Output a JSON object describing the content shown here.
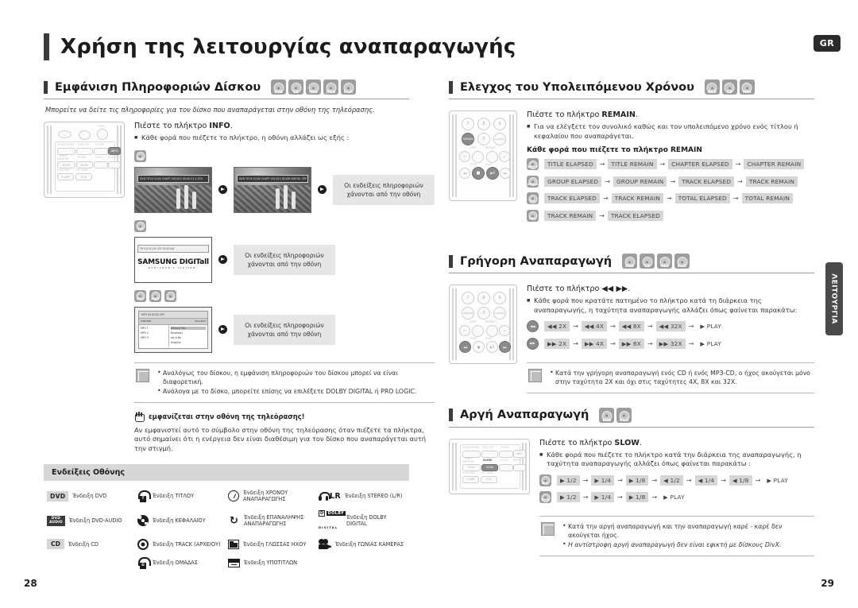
{
  "document": {
    "title": "Χρήση της λειτουργίας αναπαραγωγής",
    "locale_badge": "GR",
    "side_tab": "ΛΕΙΤΟΥΡΓΙΑ",
    "page_left": "28",
    "page_right": "29"
  },
  "sections": {
    "disc_info": {
      "heading": "Εμφάνιση Πληροφοριών Δίσκου",
      "badges": [
        "DVD",
        "CD",
        "MP3",
        "JPEG",
        "DivX"
      ],
      "intro": "Μπορείτε να δείτε τις πληροφορίες για τον δίσκο που αναπαράγεται στην οθόνη της τηλεόρασης.",
      "lead_prefix": "Πιέστε το πλήκτρο ",
      "lead_key": "INFO",
      "lead_suffix": ".",
      "bullets": [
        "Κάθε φορά που πιέζετε το πλήκτρο, η οθόνη αλλάζει ως εξής :"
      ],
      "row1_badge": "DVD",
      "row1_osd_a": "DVD  TITLE 01/05  CHAPT 001/012  00:00:21  5.1CH",
      "row1_osd_b": "DVD  TITLE 01/05  CHAPT 001/012  DOLBY DIGITAL  OFF",
      "row1_callout": "Οι ενδείξεις πληροφοριών χάνονται από την οθόνη",
      "row2_badge": "CD",
      "row2_osd": "TR  01/15  L/R  OFF  00:03:06",
      "row2_logo": "SAMSUNG DIGITall",
      "row2_logo_sub": "everyone's invited.",
      "row2_callout": "Οι ενδείξεις πληροφοριών χάνονται από την οθόνη",
      "row3_badges": [
        "MP3",
        "JPEG",
        "DivX"
      ],
      "row3_osd": "MP3  00:00:02  OFF",
      "row3_sorting": "SORTING",
      "row3_playlist": "PLAYLIST",
      "row3_left_items": [
        "MP3 1",
        "MP3 2",
        "MP3 3"
      ],
      "row3_right_items": [
        "Without You",
        "Yesterday",
        "Let it Be",
        "Imagine"
      ],
      "row3_callout": "Οι ενδείξεις πληροφοριών χάνονται από την οθόνη",
      "note_bullets": [
        "Αναλόγως του δίσκου, η εμφάνιση πληροφοριών του δίσκου μπορεί να είναι διαφορετική.",
        "Ανάλογα με το δίσκο, μπορείτε επίσης να επιλέξετε DOLBY DIGITAL ή PRO LOGIC."
      ],
      "hand_title": "εμφανίζεται στην οθόνη της τηλεόρασης!",
      "hand_body": "Αν εμφανιστεί αυτό το σύμβολο στην οθόνη της τηλεόρασης όταν πιέζετε τα πλήκτρα, αυτό σημαίνει ότι η ενέργεια δεν είναι διαθέσιμη για τον δίσκο που αναπαράγεται αυτή την στιγμή."
    },
    "osd_indicators": {
      "heading": "Ενδείξεις Οθόνης",
      "items": [
        {
          "icon": "dvd-badge-icon",
          "label": "Ένδειξη DVD"
        },
        {
          "icon": "title-icon",
          "label": "Ένδειξη ΤΙΤΛΟΥ"
        },
        {
          "icon": "play-time-icon",
          "label": "Ένδειξη ΧΡΟΝΟΥ ΑΝΑΠΑΡΑΓΩΓΗΣ"
        },
        {
          "icon": "stereo-icon",
          "label": "Ένδειξη STEREO (L/R)"
        },
        {
          "icon": "dvd-audio-badge-icon",
          "label": "Ένδειξη DVD-AUDIO"
        },
        {
          "icon": "chapter-icon",
          "label": "Ένδειξη ΚΕΦΑΛΑΙΟΥ"
        },
        {
          "icon": "repeat-icon",
          "label": "Ένδειξη ΕΠΑΝΑΛΗΨΗΣ ΑΝΑΠΑΡΑΓΩΓΗΣ"
        },
        {
          "icon": "dolby-digital-icon",
          "label": "Ένδειξη DOLBY DIGITAL"
        },
        {
          "icon": "cd-badge-icon",
          "label": "Ένδειξη CD"
        },
        {
          "icon": "track-icon",
          "label": "Ένδειξη TRACK (ΑΡΧΕΙΟΥ)"
        },
        {
          "icon": "audio-language-icon",
          "label": "Ένδειξη ΓΛΩΣΣΑΣ ΗΧΟΥ"
        },
        {
          "icon": "camera-angle-icon",
          "label": "Ένδειξη ΓΩΝΙΑΣ ΚΑΜΕΡΑΣ"
        },
        {
          "icon": "",
          "label": ""
        },
        {
          "icon": "group-icon",
          "label": "Ένδειξη ΟΜΑΔΑΣ"
        },
        {
          "icon": "subtitle-icon",
          "label": "Ένδειξη ΥΠΟΤΙΤΛΩΝ"
        },
        {
          "icon": "",
          "label": ""
        }
      ],
      "badge_dvd": "DVD",
      "badge_dvd_audio_1": "DVD",
      "badge_dvd_audio_2": "AUDIO",
      "badge_cd": "CD",
      "badge_lr": "LR",
      "badge_dolby_d": "D",
      "badge_dolby_word": "DOLBY",
      "badge_dolby_sub": "DIGITAL",
      "glyph_title": "T",
      "glyph_group": "G"
    },
    "remaining_time": {
      "heading": "Ελεγχος του Υπολειπόμενου Χρόνου",
      "badges": [
        "DVD",
        "CD",
        "MP3"
      ],
      "lead_prefix": "Πιέστε το πλήκτρο ",
      "lead_key": "REMAIN",
      "lead_suffix": ".",
      "bullets": [
        "Για να ελέγξετε τον συνολικό καθώς και τον υπολειπόμενο χρόνο ενός τίτλου ή κεφαλαίου  που αναπαράγεται."
      ],
      "subhead": "Κάθε φορά που πιέζετε το πλήκτρο REMAIN",
      "rows": [
        {
          "badge": "DVD-V",
          "chips": [
            "TITLE ELAPSED",
            "TITLE REMAIN",
            "CHAPTER ELAPSED",
            "CHAPTER REMAIN"
          ]
        },
        {
          "badge": "DVD-A",
          "chips": [
            "GROUP ELAPSED",
            "GROUP REMAIN",
            "TRACK ELAPSED",
            "TRACK REMAIN"
          ]
        },
        {
          "badge": "CD",
          "chips": [
            "TRACK ELAPSED",
            "TRACK REMAIN",
            "TOTAL ELAPSED",
            "TOTAL REMAIN"
          ]
        },
        {
          "badge": "MP3",
          "chips": [
            "TRACK REMAIN",
            "TRACK ELAPSED"
          ]
        }
      ]
    },
    "fast_play": {
      "heading": "Γρήγορη Αναπαραγωγή",
      "badges": [
        "DVD",
        "CD",
        "MP3",
        "DivX"
      ],
      "lead_prefix": "Πιέστε το πλήκτρο ",
      "lead_key": "◀◀ ▶▶",
      "lead_suffix": ".",
      "bullets": [
        "Κάθε φορά που κρατάτε πατημένο το πλήκτρο κατά τη διάρκεια της αναπαραγωγής, η ταχύτητα αναπαραγωγής αλλάζει όπως φαίνεται παρακάτω:"
      ],
      "rows": [
        {
          "badge": "◀◀",
          "chips": [
            "◀◀ 2X",
            "◀◀ 4X",
            "◀◀ 8X",
            "◀◀ 32X",
            "▶ PLAY"
          ]
        },
        {
          "badge": "▶▶",
          "chips": [
            "▶▶ 2X",
            "▶▶ 4X",
            "▶▶ 8X",
            "▶▶ 32X",
            "▶ PLAY"
          ]
        }
      ],
      "note_bullets": [
        "Κατά την γρήγορη αναπαραγωγή ενός CD ή ενός MP3-CD, ο ήχος ακούγεται μόνο στην ταχύτητα 2X και όχι στις ταχύτητες 4X, 8X και 32X."
      ]
    },
    "slow_play": {
      "heading": "Αργή Αναπαραγωγή",
      "badges": [
        "DVD",
        "DivX"
      ],
      "lead_prefix": "Πιέστε το πλήκτρο ",
      "lead_key": "SLOW",
      "lead_suffix": ".",
      "bullets": [
        "Κάθε φορά που πιέζετε το πλήκτρο κατά την διάρκεια της αναπαραγωγής, η ταχύτητα αναπαραγωγής αλλάζει όπως φαίνεται παρακάτω :"
      ],
      "rows": [
        {
          "badge": "DVD",
          "chips": [
            "▶ 1/2",
            "▶ 1/4",
            "▶ 1/8",
            "◀ 1/2",
            "◀ 1/4",
            "◀ 1/8",
            "▶ PLAY"
          ]
        },
        {
          "badge": "DivX",
          "chips": [
            "▶ 1/2",
            "▶ 1/4",
            "▶ 1/8",
            "▶ PLAY"
          ]
        }
      ],
      "note_bullets": [
        "Κατά την αργή αναπαραγωγή και την αναπαραγωγή καρέ - καρέ δεν ακούγεται ήχος.",
        "Η αντίστροφη αργή αναπαραγωγή δεν είναι εφικτή με δίσκους DivX."
      ]
    }
  },
  "remote_keys": {
    "top_labels": [
      "AUDIO MODE",
      "DVD/SET",
      "ZOOM",
      "EXIT"
    ],
    "row1": [
      "SLIDE MODE",
      "DVD SET",
      "ZOOM",
      "INFO"
    ],
    "row2": [
      "TIMER MEMORY",
      "SLOW",
      "LOGO",
      "SLEEP"
    ],
    "row3": [
      "ECHO",
      "MOVE"
    ],
    "row4": [
      "V-SOUND",
      "EZ VIEW"
    ],
    "row5": [
      "V-AMP",
      "VCR"
    ],
    "numpad": [
      "7",
      "8",
      "9",
      "REMAIN",
      "0",
      "CANCEL"
    ],
    "transport_labels": [
      "STEP",
      "REPEAT",
      "STOP",
      "PLAY"
    ]
  }
}
